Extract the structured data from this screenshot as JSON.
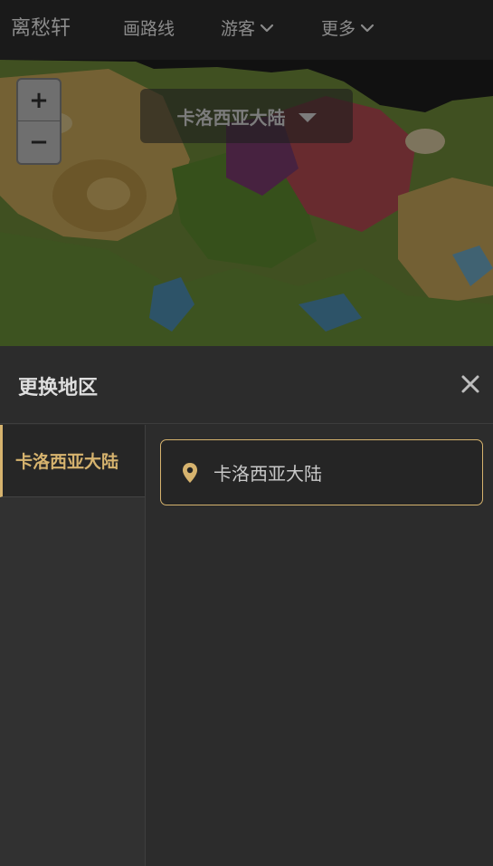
{
  "header": {
    "brand": "离愁轩",
    "nav": [
      {
        "label": "画路线",
        "has_dropdown": false
      },
      {
        "label": "游客",
        "has_dropdown": true
      },
      {
        "label": "更多",
        "has_dropdown": true
      }
    ]
  },
  "map": {
    "zoom_in_label": "+",
    "zoom_out_label": "−",
    "current_region": "卡洛西亚大陆"
  },
  "region_panel": {
    "title": "更换地区",
    "categories": [
      "卡洛西亚大陆"
    ],
    "selected_category": "卡洛西亚大陆",
    "regions": [
      {
        "name": "卡洛西亚大陆",
        "icon": "location-pin-icon"
      }
    ]
  },
  "colors": {
    "accent": "#d6b36e",
    "topbar_bg": "#1a1a1a",
    "panel_bg": "#2c2c2c"
  }
}
